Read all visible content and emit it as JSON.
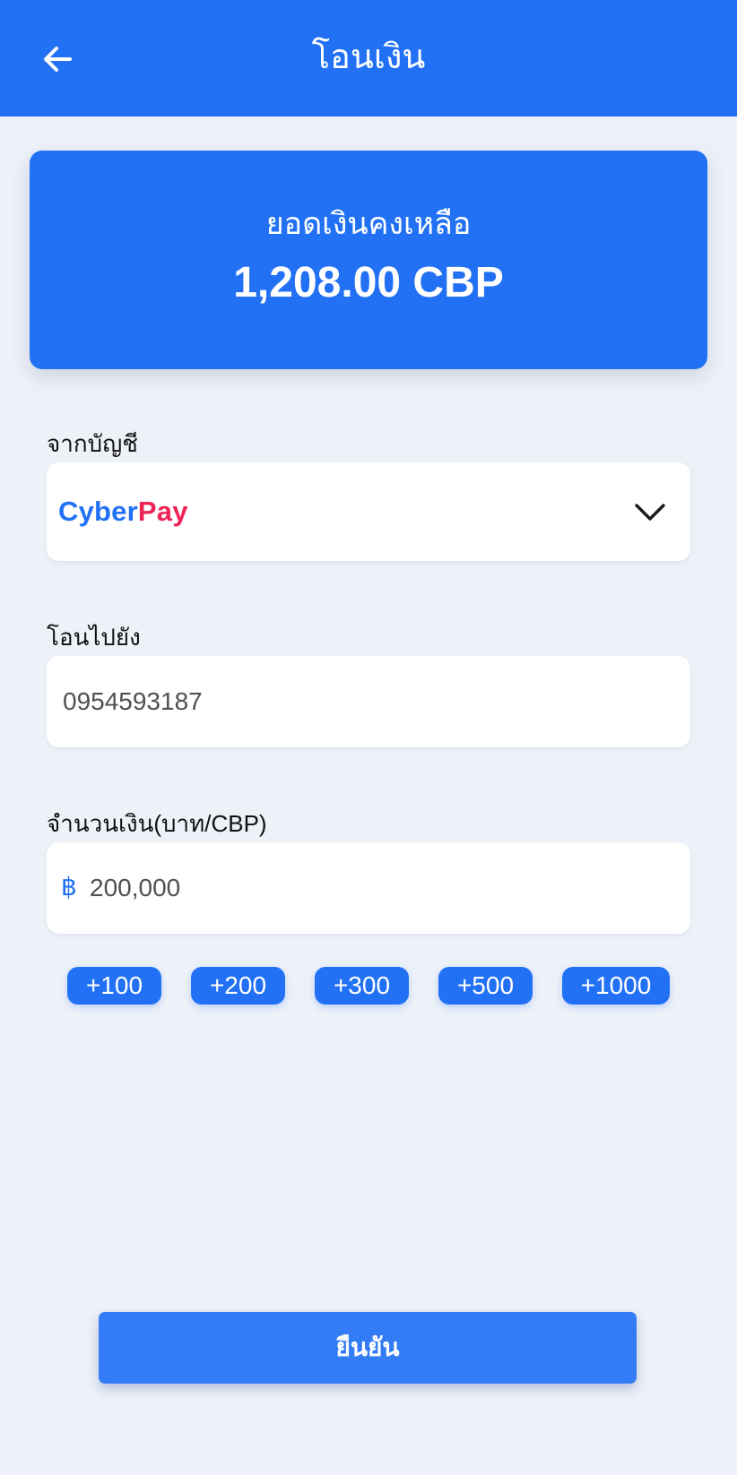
{
  "header": {
    "title": "โอนเงิน",
    "back_icon": "arrow-left-icon"
  },
  "balance": {
    "label": "ยอดเงินคงเหลือ",
    "amount": "1,208.00 CBP"
  },
  "from_account": {
    "label": "จากบัญชี",
    "brand_part1": "Cyber",
    "brand_part2": "Pay",
    "dropdown_icon": "chevron-down-icon"
  },
  "to_account": {
    "label": "โอนไปยัง",
    "value": "0954593187"
  },
  "amount": {
    "label": "จำนวนเงิน(บาท/CBP)",
    "currency_symbol": "฿",
    "value": "200,000"
  },
  "quick_amounts": [
    "+100",
    "+200",
    "+300",
    "+500",
    "+1000"
  ],
  "confirm_label": "ยืนยัน",
  "colors": {
    "primary": "#2271f5",
    "brand_secondary": "#ee2356",
    "background": "#edf1f8"
  }
}
